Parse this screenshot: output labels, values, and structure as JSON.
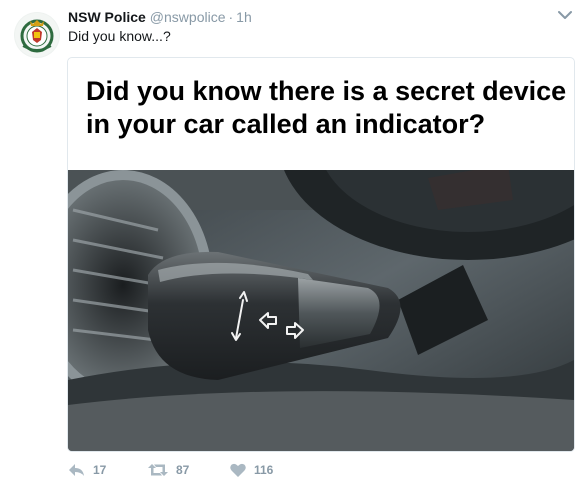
{
  "tweet": {
    "author_name": "NSW Police",
    "handle": "@nswpolice",
    "separator": "·",
    "time": "1h",
    "text": "Did you know...?"
  },
  "card": {
    "caption": "Did you know there is a secret device in your car called an indicator?"
  },
  "actions": {
    "reply_count": "17",
    "retweet_count": "87",
    "like_count": "116"
  },
  "icons": {
    "avatar": "nsw-police-badge",
    "caret": "chevron-down-icon",
    "reply": "reply-icon",
    "retweet": "retweet-icon",
    "like": "heart-icon"
  },
  "colors": {
    "name": "#14171a",
    "muted": "#8899a6",
    "border": "#e1e8ed",
    "action_icon": "#aab8c2"
  }
}
